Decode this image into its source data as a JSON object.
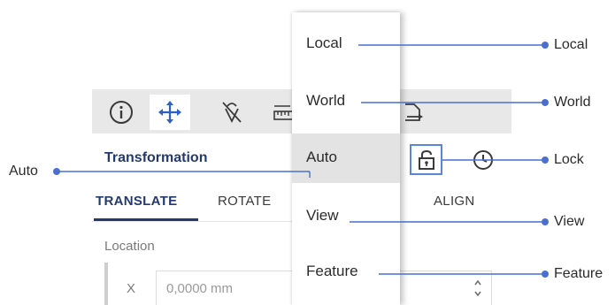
{
  "toolbar": {
    "buttons": [
      {
        "icon": "info-icon",
        "active": false
      },
      {
        "icon": "move-icon",
        "active": true
      },
      {
        "icon": "no-snap-icon",
        "active": false
      },
      {
        "icon": "ruler-icon",
        "active": false
      },
      {
        "icon": "export-icon",
        "active": false
      }
    ]
  },
  "panel": {
    "title": "Transformation",
    "tabs": [
      {
        "label": "TRANSLATE",
        "active": true
      },
      {
        "label": "ROTATE",
        "active": false
      },
      {
        "label": "ALIGN",
        "active": false
      }
    ],
    "location_label": "Location",
    "x_label": "X",
    "x_value": "0,0000 mm"
  },
  "coordinate_menu": {
    "items": [
      {
        "label": "Local",
        "selected": false
      },
      {
        "label": "World",
        "selected": false
      },
      {
        "label": "Auto",
        "selected": true
      },
      {
        "label": "View",
        "selected": false
      },
      {
        "label": "Feature",
        "selected": false
      }
    ]
  },
  "callouts": {
    "local": "Local",
    "world": "World",
    "auto": "Auto",
    "lock": "Lock",
    "view": "View",
    "feature": "Feature"
  },
  "colors": {
    "accent": "#243a6e",
    "callout": "#4a6fd0",
    "lock_border": "#5b86d6",
    "toolbar_bg": "#e8e8e8",
    "menu_selected": "#e3e3e3"
  }
}
